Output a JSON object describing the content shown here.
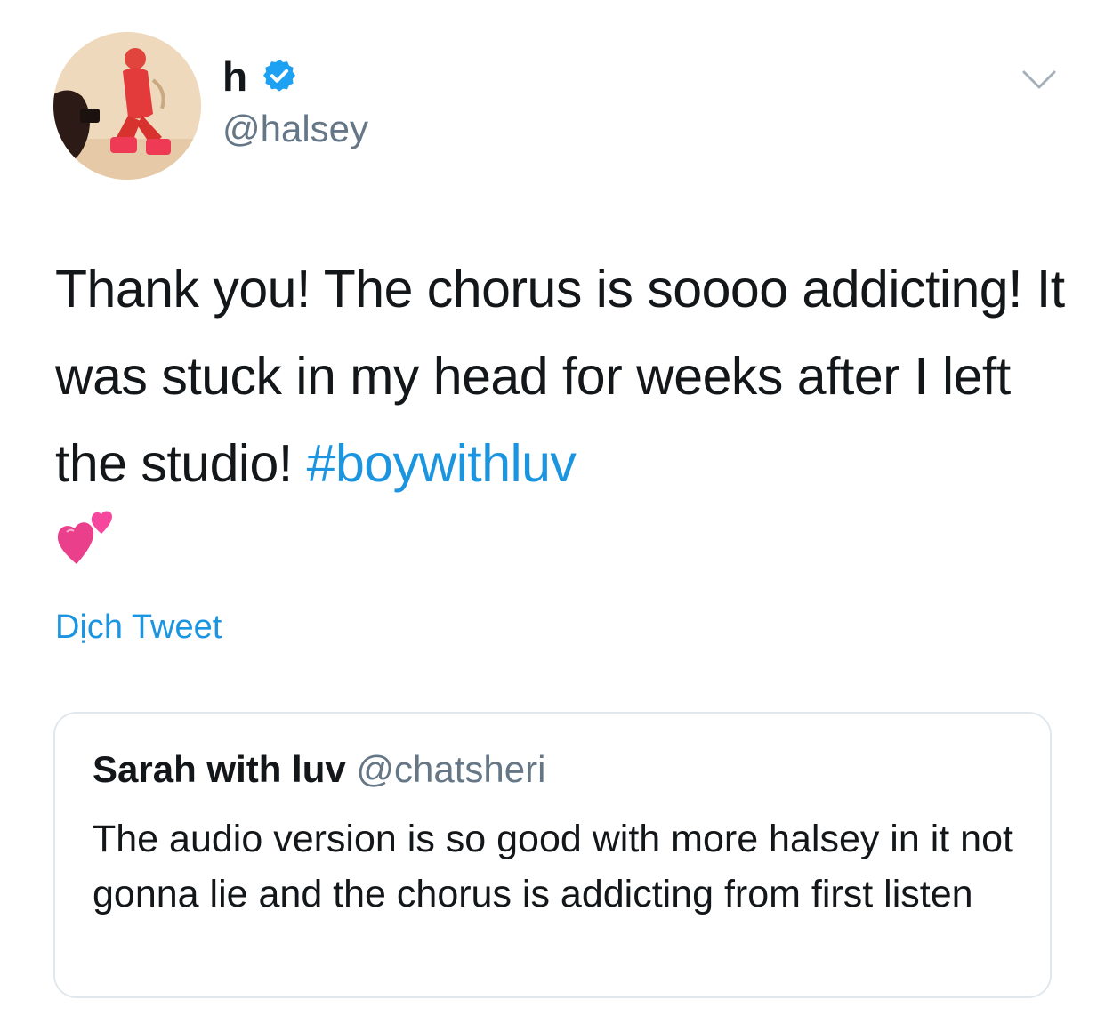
{
  "author": {
    "display_name": "h",
    "handle": "@halsey",
    "verified": true,
    "avatar_icon": "profile-photo"
  },
  "tweet": {
    "text": "Thank you! The chorus is soooo addicting! It was stuck in my head for weeks after I left the studio! ",
    "hashtag": "#boywithluv",
    "emoji": "💕",
    "translate_label": "Dịch Tweet"
  },
  "quoted_tweet": {
    "display_name": "Sarah with luv",
    "handle": "@chatsheri",
    "text": "The audio version is so good with more halsey in it not gonna lie and the chorus is addicting from first listen"
  },
  "colors": {
    "link": "#1b95e0",
    "secondary_text": "#657786",
    "border": "#e1e8ed",
    "verified": "#1da1f2"
  }
}
